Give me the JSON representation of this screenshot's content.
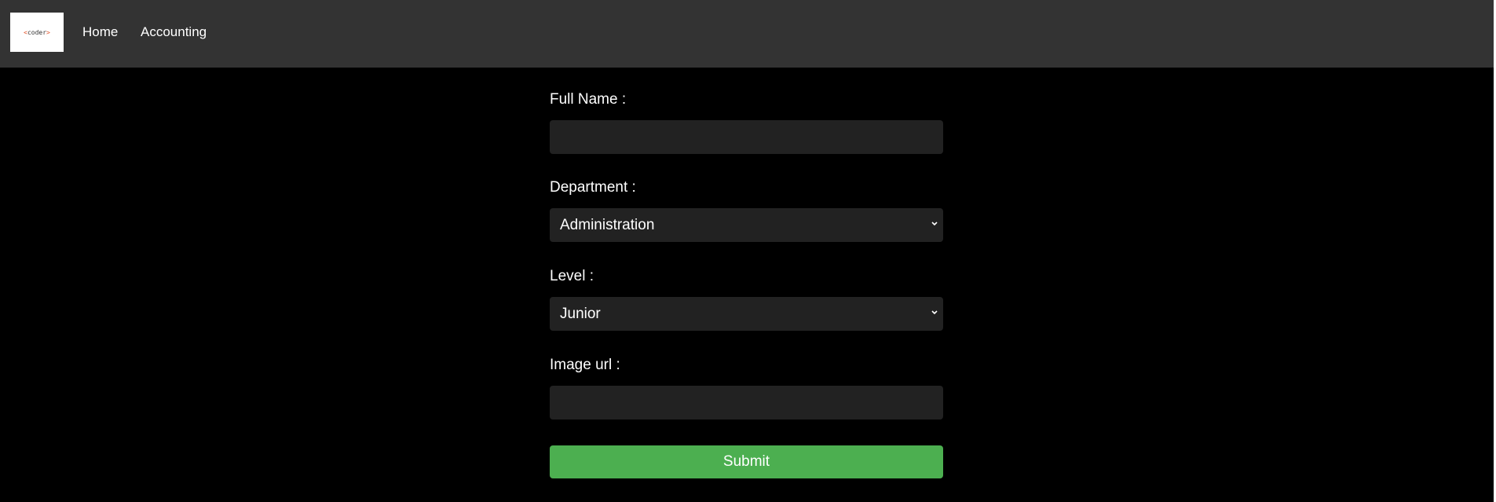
{
  "navbar": {
    "logo_text": "coder",
    "links": [
      {
        "label": "Home"
      },
      {
        "label": "Accounting"
      }
    ]
  },
  "form": {
    "full_name": {
      "label": "Full Name :",
      "value": ""
    },
    "department": {
      "label": "Department :",
      "selected": "Administration"
    },
    "level": {
      "label": "Level :",
      "selected": "Junior"
    },
    "image_url": {
      "label": "Image url :",
      "value": ""
    },
    "submit_label": "Submit"
  },
  "colors": {
    "page_background": "#000000",
    "navbar_background": "#333333",
    "field_background": "#222222",
    "submit_background": "#4caf50"
  },
  "icons": {
    "select_chevron": "chevron-down-icon"
  }
}
